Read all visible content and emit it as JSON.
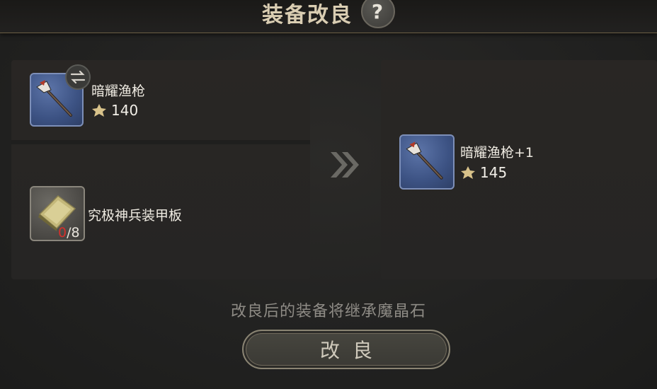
{
  "header": {
    "title": "装备改良",
    "help_label": "?"
  },
  "source_item": {
    "name": "暗耀渔枪",
    "stat_value": "140",
    "icon": "spear-icon",
    "swap_icon": "swap-icon"
  },
  "material": {
    "name": "究极神兵装甲板",
    "have": "0",
    "need": "/8",
    "icon": "armor-plate-icon"
  },
  "result_item": {
    "name": "暗耀渔枪+1",
    "stat_value": "145",
    "icon": "spear-icon"
  },
  "arrow_icon": "double-chevron-right-icon",
  "note": "改良后的装备将继承魔晶石",
  "confirm_button": {
    "label": "改良"
  },
  "colors": {
    "rare_slot": "#3c5283",
    "count_shortfall": "#d4302b",
    "stat_icon": "#d8c28a"
  }
}
